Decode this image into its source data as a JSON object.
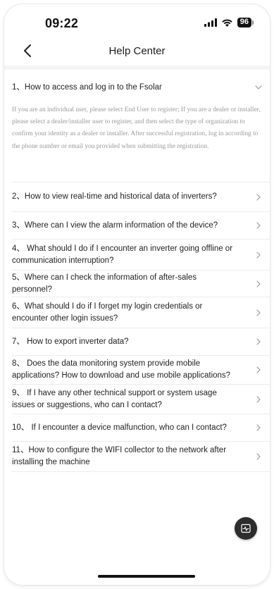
{
  "status_bar": {
    "time": "09:22",
    "battery": "96",
    "icons": [
      "signal-icon",
      "wifi-icon",
      "battery-icon"
    ]
  },
  "nav": {
    "title": "Help Center",
    "back_icon": "chevron-left-icon"
  },
  "faq": {
    "expanded": {
      "question": "1、How to access and log in to the Fsolar",
      "answer": "If you are an individual user, please select End User to register; If you are a dealer or installer, please select a dealer/installer user to register, and then select the type of organization to confirm your identity as a dealer or installer. After successful registration, log in according to the phone number or email you provided when submitting the registration."
    },
    "items": [
      {
        "question": "2、How to view real-time and historical data of inverters?"
      },
      {
        "question": "3、Where can I view the alarm information of the device?"
      },
      {
        "question": "4、 What should I do if I encounter an inverter going offline or communication interruption?"
      },
      {
        "question": "5、Where can I check the information of after-sales personnel?"
      },
      {
        "question": "6、What should I do if I forget my login credentials or encounter other login issues?"
      },
      {
        "question": "7、 How to export inverter data?"
      },
      {
        "question": "8、 Does the data monitoring system provide mobile applications? How to download and use mobile applications?"
      },
      {
        "question": "9、 If I have any other technical support or system usage issues or suggestions, who can I contact?"
      },
      {
        "question": "10、 If I encounter a device malfunction, who can I contact?"
      },
      {
        "question": "11、How to configure the WIFI collector to the network after installing the machine"
      }
    ]
  },
  "fab": {
    "icon": "activity-monitor-icon"
  },
  "colors": {
    "text": "#222222",
    "answer_text": "#9a9a9a",
    "divider": "#ececec",
    "fab_bg": "#2d2d2d"
  }
}
